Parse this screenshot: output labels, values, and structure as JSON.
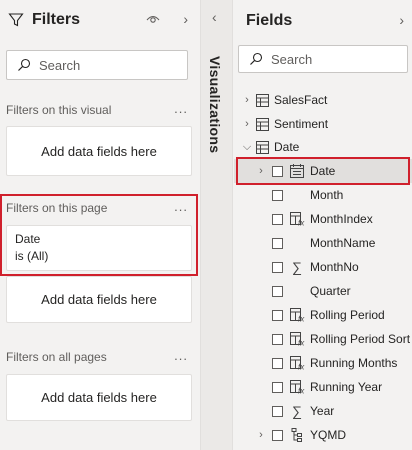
{
  "filters": {
    "title": "Filters",
    "search_placeholder": "Search",
    "visual": {
      "title": "Filters on this visual",
      "more": "...",
      "add_label": "Add data fields here"
    },
    "page": {
      "title": "Filters on this page",
      "more": "...",
      "date_filter": {
        "name": "Date",
        "state": "is (All)"
      },
      "add_label": "Add data fields here"
    },
    "all_pages": {
      "title": "Filters on all pages",
      "more": "...",
      "add_label": "Add data fields here"
    }
  },
  "visualizations": {
    "label": "Visualizations"
  },
  "fields": {
    "title": "Fields",
    "search_placeholder": "Search",
    "tables": [
      {
        "name": "SalesFact",
        "icon": "table-icon",
        "expanded": false
      },
      {
        "name": "Sentiment",
        "icon": "table-icon",
        "expanded": false
      },
      {
        "name": "Date",
        "icon": "table-icon",
        "expanded": true
      }
    ],
    "date_fields": [
      {
        "name": "Date",
        "icon": "calendar-icon",
        "expandable": true,
        "selected": true
      },
      {
        "name": "Month",
        "icon": "",
        "expandable": false
      },
      {
        "name": "MonthIndex",
        "icon": "calc-column-icon",
        "expandable": false
      },
      {
        "name": "MonthName",
        "icon": "",
        "expandable": false
      },
      {
        "name": "MonthNo",
        "icon": "sigma-icon",
        "expandable": false
      },
      {
        "name": "Quarter",
        "icon": "",
        "expandable": false
      },
      {
        "name": "Rolling Period",
        "icon": "calc-column-icon",
        "expandable": false
      },
      {
        "name": "Rolling Period Sort",
        "icon": "calc-column-icon",
        "expandable": false
      },
      {
        "name": "Running Months",
        "icon": "calc-column-icon",
        "expandable": false
      },
      {
        "name": "Running Year",
        "icon": "calc-column-icon",
        "expandable": false
      },
      {
        "name": "Year",
        "icon": "sigma-icon",
        "expandable": false
      },
      {
        "name": "YQMD",
        "icon": "hierarchy-icon",
        "expandable": true
      }
    ]
  },
  "colors": {
    "highlight": "#d0202c",
    "pane": "#f3f2f1",
    "card": "#ffffff"
  }
}
